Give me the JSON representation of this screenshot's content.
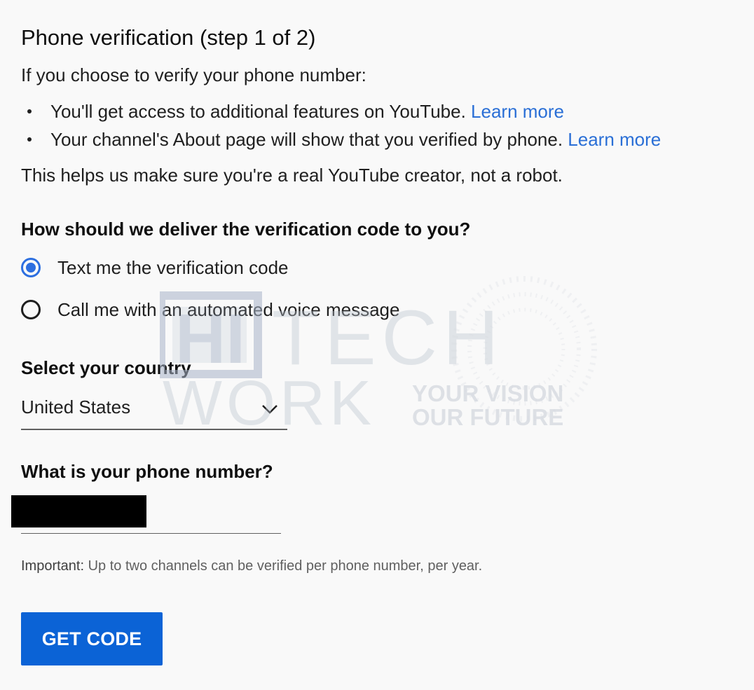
{
  "title": "Phone verification (step 1 of 2)",
  "intro": "If you choose to verify your phone number:",
  "bullets": [
    {
      "text": "You'll get access to additional features on YouTube. ",
      "link": "Learn more"
    },
    {
      "text": "Your channel's About page will show that you verified by phone. ",
      "link": "Learn more"
    }
  ],
  "helps": "This helps us make sure you're a real YouTube creator, not a robot.",
  "delivery": {
    "question": "How should we deliver the verification code to you?",
    "options": [
      {
        "label": "Text me the verification code",
        "selected": true
      },
      {
        "label": "Call me with an automated voice message",
        "selected": false
      }
    ]
  },
  "country": {
    "question": "Select your country",
    "value": "United States"
  },
  "phone": {
    "question": "What is your phone number?",
    "value": ""
  },
  "important": {
    "prefix": "Important:",
    "text": " Up to two channels can be verified per phone number, per year."
  },
  "button": {
    "label": "GET CODE",
    "color": "#0b63d6"
  },
  "watermark": {
    "line1": "HI TECH",
    "line2": "WORK",
    "tagline1": "YOUR VISION",
    "tagline2": "OUR FUTURE"
  },
  "colors": {
    "link": "#2a6fd6",
    "radio_selected": "#2d6fe0"
  }
}
